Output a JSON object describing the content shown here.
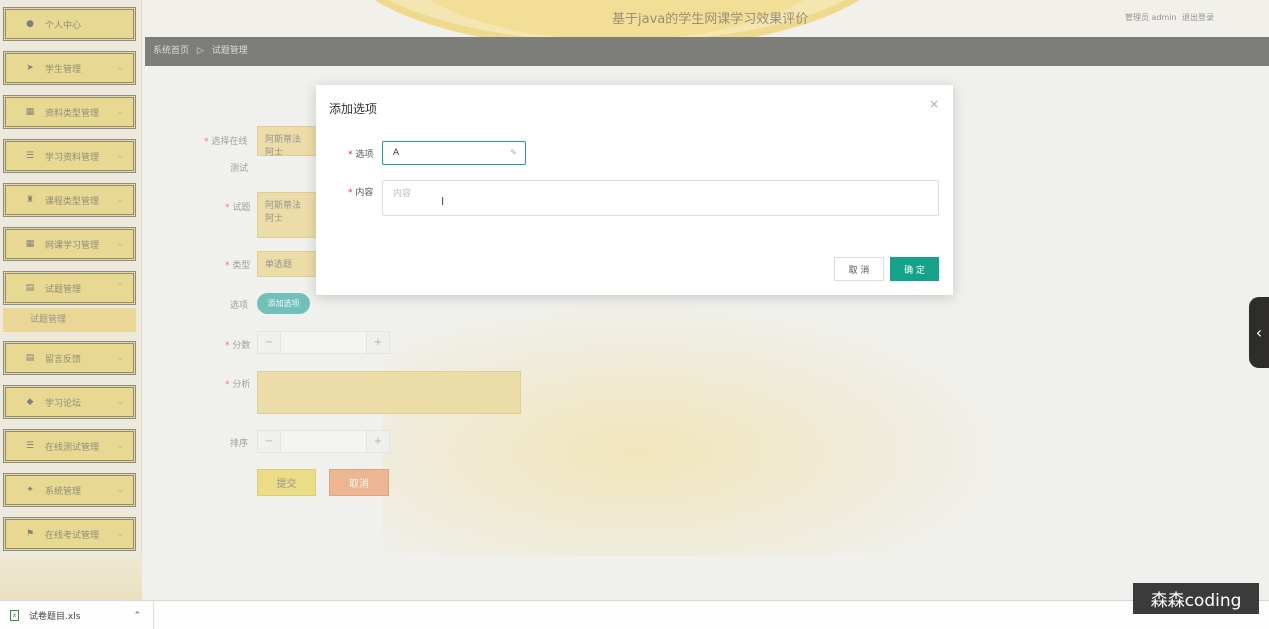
{
  "header": {
    "title": "基于java的学生网课学习效果评价",
    "user": "管理员 admin",
    "logout": "退出登录"
  },
  "breadcrumb": {
    "home": "系统首页",
    "separator": "▷",
    "current": "试题管理"
  },
  "sidebar": {
    "items": [
      {
        "label": "个人中心",
        "icon": "user-icon"
      },
      {
        "label": "学生管理",
        "icon": "send-icon"
      },
      {
        "label": "资料类型管理",
        "icon": "grid-icon"
      },
      {
        "label": "学习资料管理",
        "icon": "list-icon"
      },
      {
        "label": "课程类型管理",
        "icon": "trophy-icon"
      },
      {
        "label": "网课学习管理",
        "icon": "grid-icon"
      },
      {
        "label": "试题管理",
        "icon": "clipboard-icon"
      },
      {
        "label": "留言反馈",
        "icon": "clipboard-icon"
      },
      {
        "label": "学习论坛",
        "icon": "pin-icon"
      },
      {
        "label": "在线测试管理",
        "icon": "list-icon"
      },
      {
        "label": "系统管理",
        "icon": "gamepad-icon"
      },
      {
        "label": "在线考试管理",
        "icon": "flag-icon"
      }
    ],
    "active_sub": "试题管理"
  },
  "form": {
    "paper_label_1": "选择在线",
    "paper_label_2": "测试",
    "paper_value": "阿斯蒂法阿士",
    "question_label": "试题",
    "question_value": "阿斯蒂法阿士",
    "type_label": "类型",
    "type_value": "单选题",
    "options_label": "选项",
    "add_option_button": "添加选项",
    "score_label": "分数",
    "analysis_label": "分析",
    "sort_label": "排序",
    "submit_button": "提交",
    "cancel_button": "取消"
  },
  "modal": {
    "title": "添加选项",
    "option_label": "选项",
    "option_value": "A",
    "content_label": "内容",
    "content_placeholder": "内容",
    "cancel": "取 消",
    "confirm": "确 定"
  },
  "download_bar": {
    "file_name": "试卷题目.xls"
  },
  "watermark": "森森coding"
}
